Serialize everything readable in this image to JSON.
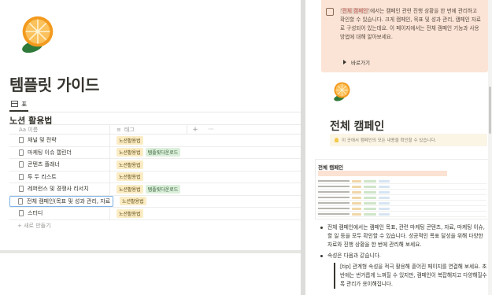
{
  "left": {
    "page_title": "템플릿 가이드",
    "view_tab": "표",
    "db_title": "노션 활용법",
    "columns": {
      "name": "Aa 이름",
      "tag": "태그",
      "add": "+",
      "more": "···"
    },
    "rows": [
      {
        "name": "채널 및 전략",
        "tags": [
          {
            "label": "노션활용법",
            "color": "yellow"
          }
        ]
      },
      {
        "name": "마케팅 이슈 캘린더",
        "tags": [
          {
            "label": "노션활용법",
            "color": "yellow"
          },
          {
            "label": "템플릿다운로드",
            "color": "green"
          }
        ]
      },
      {
        "name": "콘텐츠 플래너",
        "tags": [
          {
            "label": "노션활용법",
            "color": "yellow"
          }
        ]
      },
      {
        "name": "투 두 리스트",
        "tags": [
          {
            "label": "노션활용법",
            "color": "yellow"
          }
        ]
      },
      {
        "name": "레퍼런스 및 경쟁사 리서치",
        "tags": [
          {
            "label": "노션활용법",
            "color": "yellow"
          },
          {
            "label": "템플릿다운로드",
            "color": "green"
          }
        ]
      },
      {
        "name": "전체 캠페인(목표 및 성과 관리, 자료 관리)",
        "tags": [
          {
            "label": "노션활용법",
            "color": "yellow"
          }
        ],
        "active": true
      },
      {
        "name": "스터디",
        "tags": [
          {
            "label": "노션활용법",
            "color": "yellow"
          }
        ]
      }
    ],
    "new_row": "+ 새로 만들기"
  },
  "right": {
    "callout_code": "'전체 캠페인'",
    "callout_text": "에서는 캠페인 관련 진행 상황을 한 번에 관리하고 확인할 수 있습니다. 크게 캠페인, 목표 및 성과 관리, 캠페인 자료로 구성되어 있는데요. 이 페이지에서는 전체 캠페인 기능과 사용 방법에 대해 알아보세요.",
    "toggle_label": "바로가기",
    "title": "전체 캠페인",
    "note": "이 곳에서 캠페인의 모든 내용을 확인할 수 있습니다.",
    "card_title": "전체 캠페인",
    "bullet1": "전체 캠페인에서는 캠페인 목표, 관련 마케팅 콘텐츠, 자료, 마케팅 이슈, 할 일 등을 모두 확인할 수 있습니다. 성공적인 목표 달성을 위해 다양한 자료와 진행 상황을 한 번에 관리해 보세요.",
    "bullet2": "속성은 다음과 같습니다.",
    "tip": "[tip] 관계형 속성을 적극 활용해 흩어진 페이지를 연결해 보세요. 초반에는 번거롭게 느껴질 수 있지만, 캠페인이 복잡해지고 다양해질수록 관리가 용이해집니다."
  },
  "colors": {
    "callout_bg": "#fbe4d6",
    "tag_yellow": "#fbecc4",
    "tag_green": "#dcefdc",
    "active_border": "#7db3e8"
  },
  "icons": [
    "orange-slice-icon",
    "table-icon",
    "document-icon",
    "bulb-icon"
  ]
}
